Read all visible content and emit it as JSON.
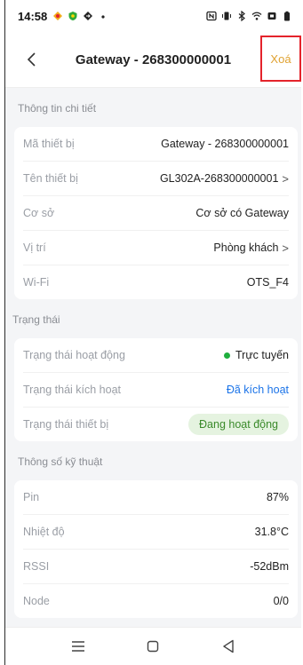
{
  "status_bar": {
    "time": "14:58",
    "left_icons": [
      "notification-app-icon",
      "shield-icon",
      "navigation-icon",
      "dot-icon"
    ],
    "right_icons": [
      "nfc-icon",
      "vibrate-icon",
      "bluetooth-icon",
      "wifi-icon",
      "battery-saver-icon",
      "battery-icon"
    ]
  },
  "header": {
    "title": "Gateway - 268300000001",
    "delete_label": "Xoá"
  },
  "sections": {
    "details": {
      "title": "Thông tin chi tiết",
      "rows": [
        {
          "label": "Mã thiết bị",
          "value": "Gateway - 268300000001"
        },
        {
          "label": "Tên thiết bị",
          "value": "GL302A-268300000001"
        },
        {
          "label": "Cơ sở",
          "value": "Cơ sở có Gateway"
        },
        {
          "label": "Vị trí",
          "value": "Phòng khách"
        },
        {
          "label": "Wi-Fi",
          "value": "OTS_F4"
        }
      ]
    },
    "status": {
      "title": "Trạng thái",
      "rows": [
        {
          "label": "Trạng thái hoạt động",
          "value": "Trực tuyến"
        },
        {
          "label": "Trạng thái kích hoạt",
          "value": "Đã kích hoạt"
        },
        {
          "label": "Trạng thái thiết bị",
          "value": "Đang hoạt động"
        }
      ]
    },
    "specs": {
      "title": "Thông số kỹ thuật",
      "rows": [
        {
          "label": "Pin",
          "value": "87%"
        },
        {
          "label": "Nhiệt độ",
          "value": "31.8°C"
        },
        {
          "label": "RSSI",
          "value": "-52dBm"
        },
        {
          "label": "Node",
          "value": "0/0"
        }
      ]
    }
  },
  "colors": {
    "delete_text": "#e0a231",
    "highlight_border": "#e4232b",
    "online_dot": "#1fae3e",
    "link_blue": "#1a73e8",
    "pill_bg": "#e5f3e0",
    "pill_text": "#3a8a2a"
  },
  "nav_bar": {
    "buttons": [
      "menu-icon",
      "home-icon",
      "back-triangle-icon"
    ]
  }
}
